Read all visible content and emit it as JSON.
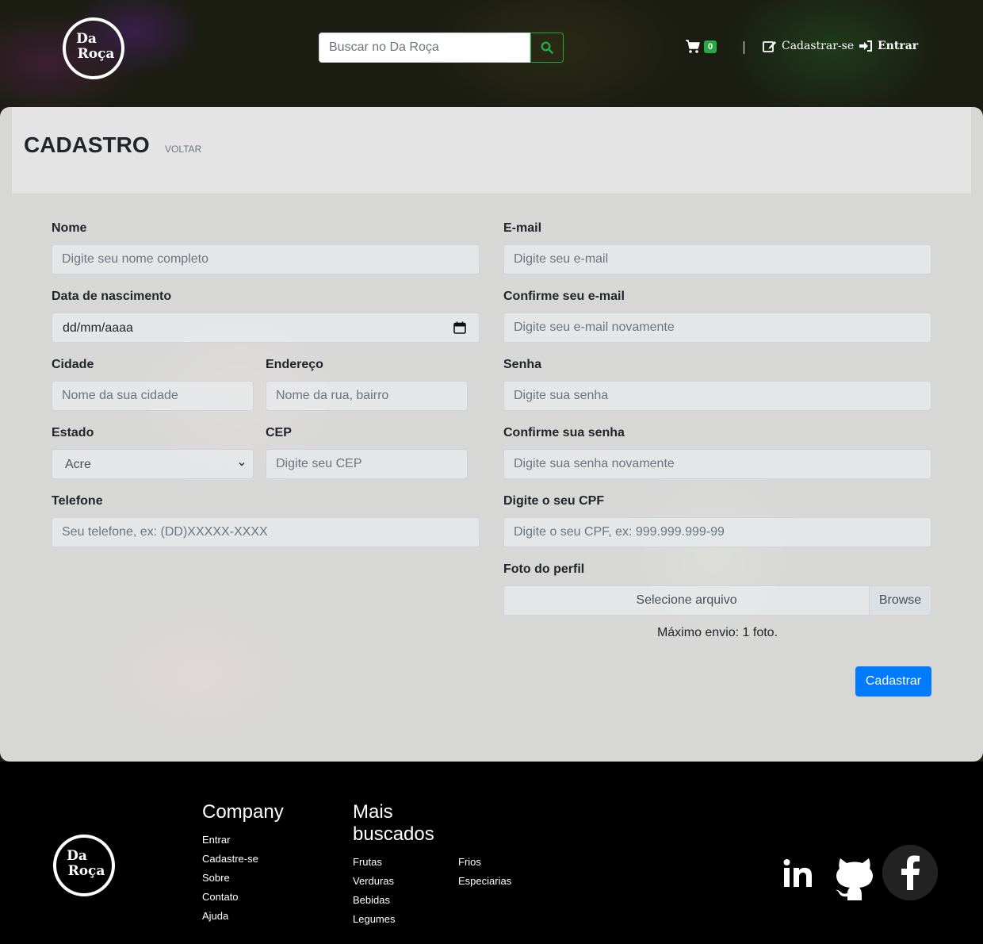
{
  "header": {
    "logo_line1": "Da",
    "logo_line2": "Roça",
    "search_placeholder": "Buscar no Da Roça",
    "cart_count": "0",
    "signup_label": "Cadastrar-se",
    "login_label": "Entrar"
  },
  "page": {
    "title": "CADASTRO",
    "back_label": "VOLTAR"
  },
  "form": {
    "nome": {
      "label": "Nome",
      "placeholder": "Digite seu nome completo"
    },
    "nascimento": {
      "label": "Data de nascimento",
      "value": "dd/mm/aaaa"
    },
    "cidade": {
      "label": "Cidade",
      "placeholder": "Nome da sua cidade"
    },
    "endereco": {
      "label": "Endereço",
      "placeholder": "Nome da rua, bairro"
    },
    "estado": {
      "label": "Estado",
      "value": "Acre"
    },
    "cep": {
      "label": "CEP",
      "placeholder": "Digite seu CEP"
    },
    "telefone": {
      "label": "Telefone",
      "placeholder": "Seu telefone, ex: (DD)XXXXX-XXXX"
    },
    "email": {
      "label": "E-mail",
      "placeholder": "Digite seu e-mail"
    },
    "email_confirm": {
      "label": "Confirme seu e-mail",
      "placeholder": "Digite seu e-mail novamente"
    },
    "senha": {
      "label": "Senha",
      "placeholder": "Digite sua senha"
    },
    "senha_confirm": {
      "label": "Confirme sua senha",
      "placeholder": "Digite sua senha novamente"
    },
    "cpf": {
      "label": "Digite o seu CPF",
      "placeholder": "Digite o seu CPF, ex: 999.999.999-99"
    },
    "foto": {
      "label": "Foto do perfil",
      "file_label": "Selecione arquivo",
      "browse_label": "Browse",
      "hint": "Máximo envio: 1 foto."
    },
    "submit_label": "Cadastrar"
  },
  "footer": {
    "logo_line1": "Da",
    "logo_line2": "Roça",
    "company_heading": "Company",
    "company_links": [
      "Entrar",
      "Cadastre-se",
      "Sobre",
      "Contato",
      "Ajuda"
    ],
    "popular_heading_1": "Mais",
    "popular_heading_2": "buscados",
    "popular_col1": [
      "Frutas",
      "Verduras",
      "Bebidas",
      "Legumes"
    ],
    "popular_col2": [
      "Frios",
      "Especiarias"
    ],
    "social_icons": [
      "linkedin-icon",
      "github-icon",
      "facebook-icon"
    ]
  },
  "colors": {
    "accent_green": "#28a745",
    "primary_blue": "#007bff"
  }
}
